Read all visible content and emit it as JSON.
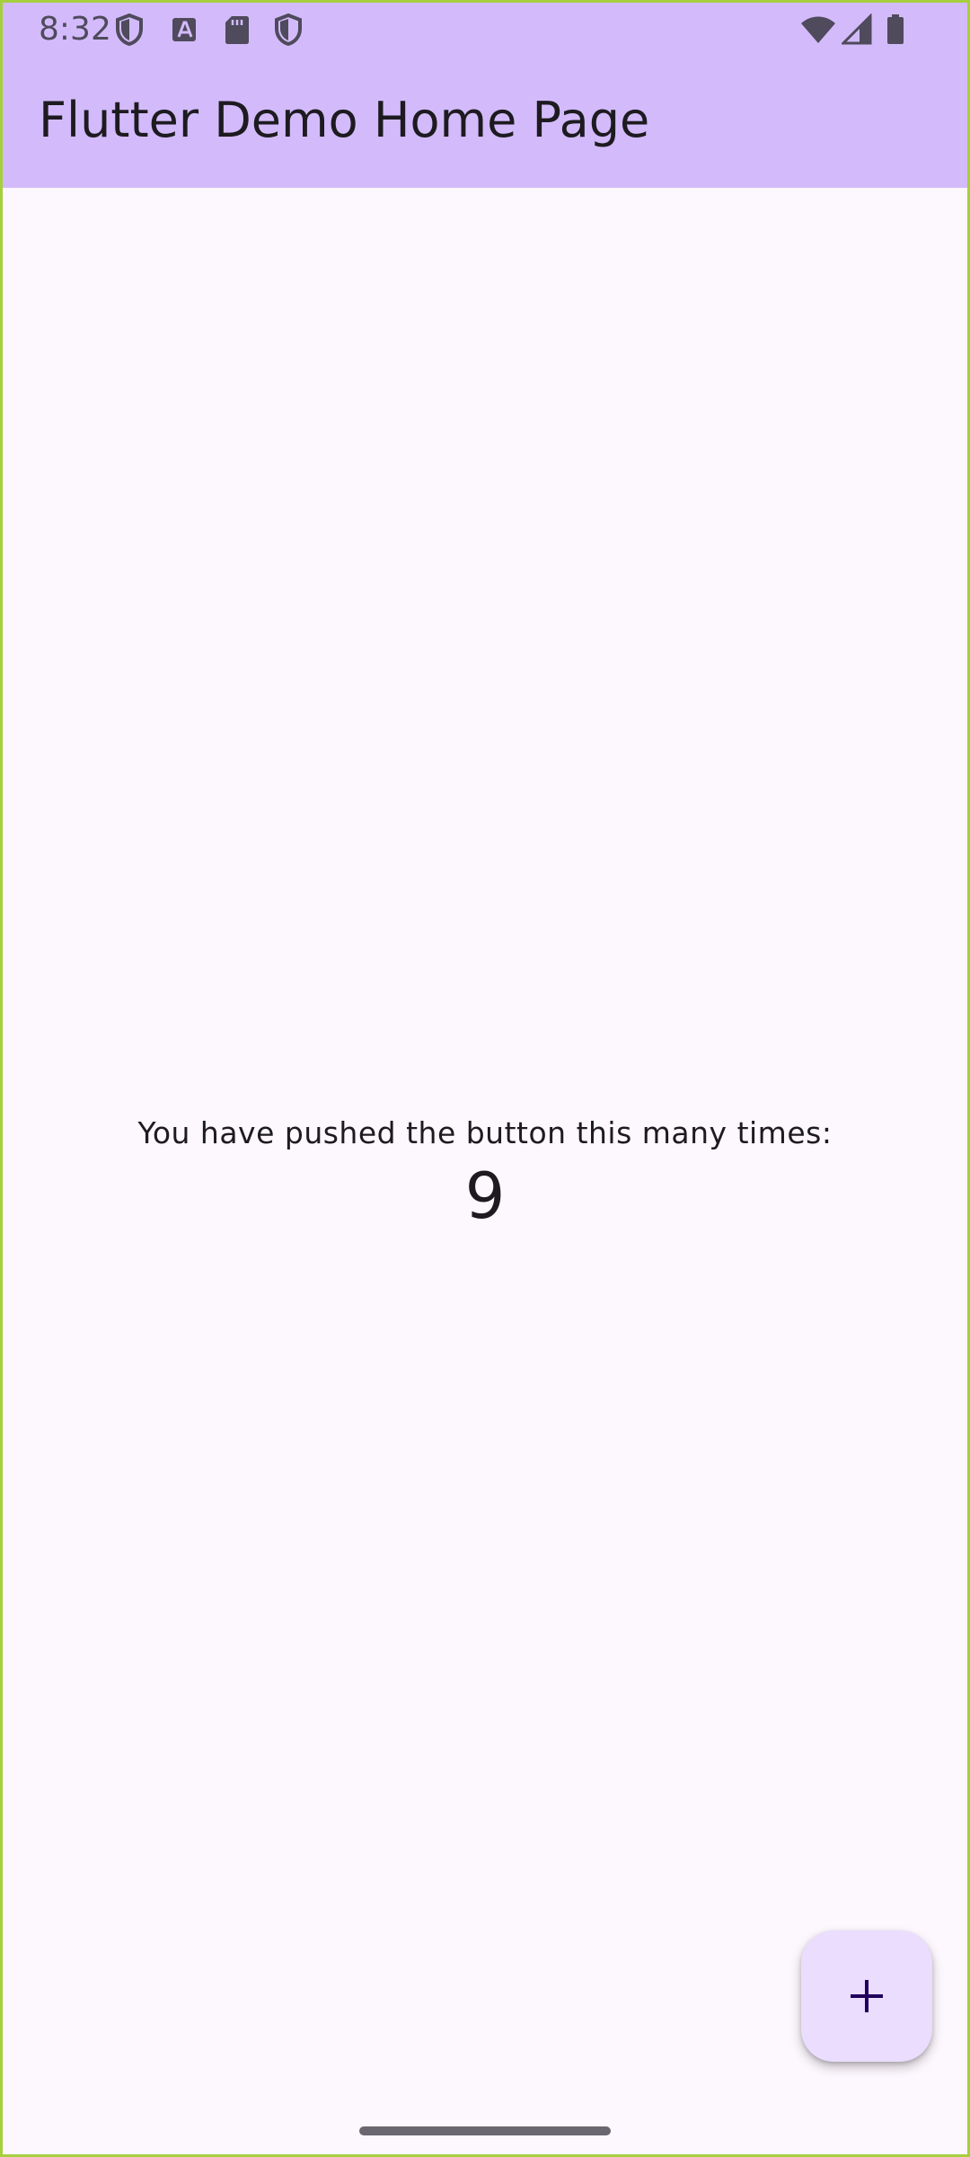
{
  "status_bar": {
    "time": "8:32",
    "left_icons": [
      "shield-icon",
      "font-a-icon",
      "sd-card-icon",
      "shield-icon"
    ],
    "right_icons": [
      "wifi-icon",
      "cellular-signal-icon",
      "battery-icon"
    ],
    "icon_color": "#4f4a5c"
  },
  "app_bar": {
    "title": "Flutter Demo Home Page",
    "background": "#d3bbfb"
  },
  "main": {
    "caption": "You have pushed the button this many times:",
    "counter": "9"
  },
  "fab": {
    "icon": "plus-icon",
    "background": "#eaddfe"
  },
  "colors": {
    "page_background": "#fdf7fe",
    "text": "#1d1b20",
    "device_frame": "#a6cf3e"
  }
}
